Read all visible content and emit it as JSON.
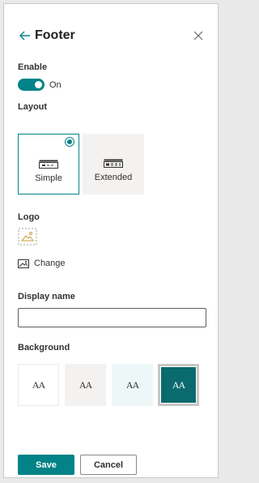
{
  "panel": {
    "title": "Footer",
    "back_icon": "arrow-left-icon",
    "close_icon": "close-icon"
  },
  "enable": {
    "label": "Enable",
    "state_text": "On",
    "on": true
  },
  "layout": {
    "label": "Layout",
    "options": [
      {
        "label": "Simple",
        "selected": true,
        "icon": "layout-simple-icon"
      },
      {
        "label": "Extended",
        "selected": false,
        "icon": "layout-extended-icon"
      }
    ]
  },
  "logo": {
    "label": "Logo",
    "image_icon": "image-placeholder-icon",
    "change_label": "Change",
    "change_icon": "picture-icon"
  },
  "display_name": {
    "label": "Display name",
    "value": "",
    "placeholder": ""
  },
  "background": {
    "label": "Background",
    "swatch_text": "AA",
    "swatches": [
      {
        "name": "white",
        "color": "#ffffff",
        "selected": false
      },
      {
        "name": "neutral",
        "color": "#f3f2f1",
        "selected": false
      },
      {
        "name": "soft",
        "color": "#eef7f8",
        "selected": false
      },
      {
        "name": "strong",
        "color": "#0b6a6e",
        "selected": true
      }
    ]
  },
  "actions": {
    "save_label": "Save",
    "cancel_label": "Cancel"
  },
  "colors": {
    "accent": "#038387",
    "panel_bg": "#ffffff",
    "page_bg": "#e9e9e9"
  }
}
